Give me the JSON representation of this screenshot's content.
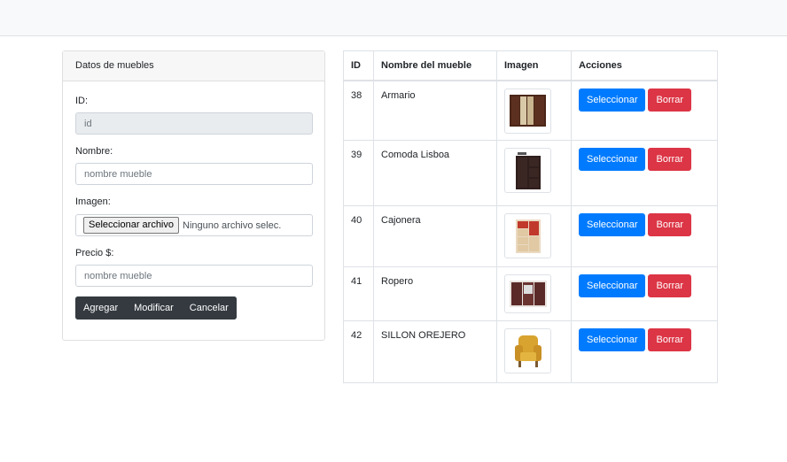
{
  "form": {
    "title": "Datos de muebles",
    "id_label": "ID:",
    "id_placeholder": "id",
    "name_label": "Nombre:",
    "name_placeholder": "nombre mueble",
    "image_label": "Imagen:",
    "file_button": "Seleccionar archivo",
    "file_status": "Ninguno archivo selec.",
    "price_label": "Precio $:",
    "price_placeholder": "nombre mueble",
    "buttons": {
      "add": "Agregar",
      "modify": "Modificar",
      "cancel": "Cancelar"
    }
  },
  "table": {
    "headers": [
      "ID",
      "Nombre del mueble",
      "Imagen",
      "Acciones"
    ],
    "select_label": "Seleccionar",
    "delete_label": "Borrar",
    "rows": [
      {
        "id": "38",
        "name": "Armario",
        "image": "wardrobe-image"
      },
      {
        "id": "39",
        "name": "Comoda Lisboa",
        "image": "dresser-image"
      },
      {
        "id": "40",
        "name": "Cajonera",
        "image": "drawer-unit-image"
      },
      {
        "id": "41",
        "name": "Ropero",
        "image": "closet-image"
      },
      {
        "id": "42",
        "name": "SILLON OREJERO",
        "image": "armchair-image"
      }
    ]
  },
  "colors": {
    "primary": "#007bff",
    "danger": "#dc3545",
    "dark": "#343a40"
  }
}
